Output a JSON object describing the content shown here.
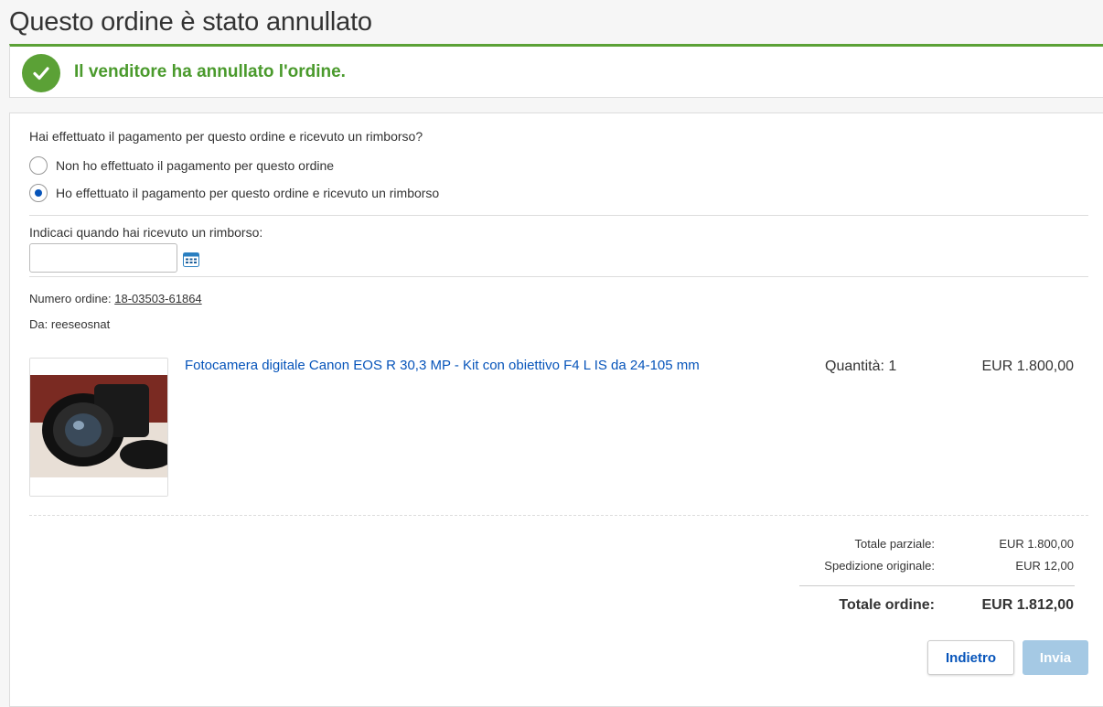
{
  "page": {
    "title": "Questo ordine è stato annullato"
  },
  "banner": {
    "message": "Il venditore ha annullato l'ordine.",
    "status_color": "#5ba136"
  },
  "payment": {
    "question": "Hai effettuato il pagamento per questo ordine e ricevuto un rimborso?",
    "options": [
      {
        "label": "Non ho effettuato il pagamento per questo ordine",
        "selected": false
      },
      {
        "label": "Ho effettuato il pagamento per questo ordine e ricevuto un rimborso",
        "selected": true
      }
    ]
  },
  "refund_date": {
    "label": "Indicaci quando hai ricevuto un rimborso:",
    "value": "",
    "icon": "calendar-icon"
  },
  "order": {
    "number_label": "Numero ordine:",
    "number": "18-03503-61864",
    "from_label": "Da:",
    "from": "reeseosnat"
  },
  "item": {
    "title": "Fotocamera digitale Canon EOS R 30,3 MP - Kit con obiettivo F4 L IS da 24-105 mm",
    "quantity_label": "Quantità: 1",
    "price": "EUR 1.800,00"
  },
  "summary": {
    "subtotal_label": "Totale parziale:",
    "subtotal": "EUR 1.800,00",
    "shipping_label": "Spedizione originale:",
    "shipping": "EUR 12,00",
    "total_label": "Totale ordine:",
    "total": "EUR 1.812,00"
  },
  "actions": {
    "back_label": "Indietro",
    "send_label": "Invia"
  },
  "colors": {
    "link": "#0654ba",
    "success": "#5ba136",
    "disabled_button": "#a5c9e4"
  }
}
